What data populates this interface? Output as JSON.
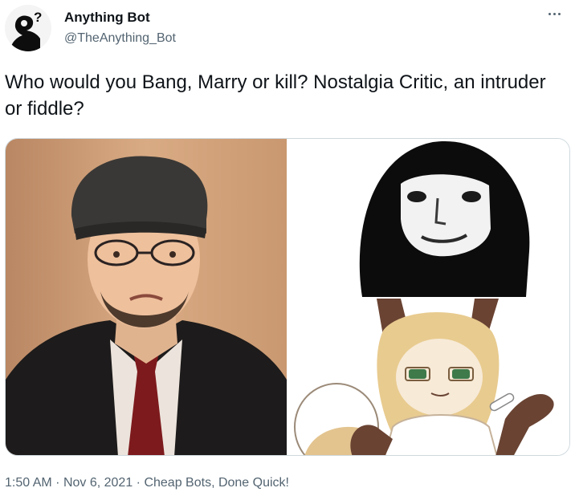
{
  "author": {
    "display_name": "Anything Bot",
    "handle": "@TheAnything_Bot",
    "avatar_icon": "question-bust-icon"
  },
  "more_icon": "more-options-icon",
  "tweet": {
    "text": "Who would you Bang, Marry or kill? Nostalgia Critic, an intruder or fiddle?"
  },
  "media": {
    "images": [
      {
        "subject": "nostalgia-critic-photo"
      },
      {
        "subject": "intruder-face-image"
      },
      {
        "subject": "fiddle-fox-drawing"
      }
    ]
  },
  "meta": {
    "time": "1:50 AM",
    "date": "Nov 6, 2021",
    "source": "Cheap Bots, Done Quick!",
    "separator": "·"
  },
  "colors": {
    "text_primary": "#0f1419",
    "text_secondary": "#536471",
    "border": "#cfd9de"
  }
}
